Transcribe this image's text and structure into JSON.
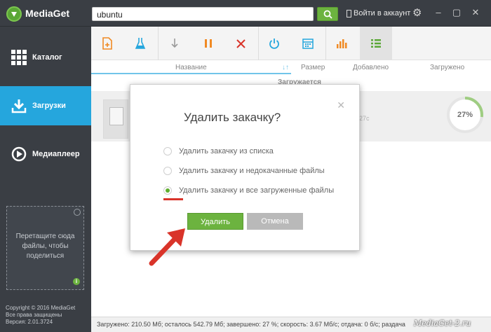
{
  "app": {
    "title": "MediaGet"
  },
  "search": {
    "value": "ubuntu"
  },
  "header": {
    "login_label": "Войти в аккаунт"
  },
  "sidebar": {
    "items": [
      {
        "label": "Каталог",
        "icon": "grid-icon"
      },
      {
        "label": "Загрузки",
        "icon": "download-icon",
        "active": true
      },
      {
        "label": "Медиаплеер",
        "icon": "play-icon"
      }
    ],
    "drop_zone": "Перетащите сюда файлы, чтобы поделиться",
    "copyright_lines": [
      "Copyright © 2016 MediaGet",
      "Все права защищены",
      "Версия: 2.01.3724"
    ]
  },
  "toolbar": {
    "icons": [
      "add-file-icon",
      "flask-icon",
      "download-icon",
      "pause-icon",
      "delete-icon",
      "power-icon",
      "calendar-icon",
      "stats-icon",
      "list-icon"
    ]
  },
  "table": {
    "columns": {
      "name": "Название",
      "size": "Размер",
      "added": "Добавлено",
      "loaded": "Загружено"
    },
    "section_label": "Загружается",
    "row": {
      "hash_fragment": "27c",
      "progress_percent": 27,
      "progress_label": "27%"
    }
  },
  "dialog": {
    "title": "Удалить закачку?",
    "options": [
      {
        "label": "Удалить закачку из списка",
        "checked": false
      },
      {
        "label": "Удалить закачку и недокачанные файлы",
        "checked": false
      },
      {
        "label": "Удалить закачку и все загруженные файлы",
        "checked": true
      }
    ],
    "confirm_label": "Удалить",
    "cancel_label": "Отмена"
  },
  "statusbar": {
    "text": "Загружено: 210.50 Мб; осталось 542.79 Мб; завершено: 27 %; скорость: 3.67 Мб/с; отдача: 0 б/с; раздача"
  },
  "watermark": "MediaGet-2.ru",
  "colors": {
    "accent_blue": "#25a6dd",
    "accent_green": "#6cb33f",
    "toolbar_orange": "#f08a24",
    "toolbar_red": "#d9342a"
  }
}
